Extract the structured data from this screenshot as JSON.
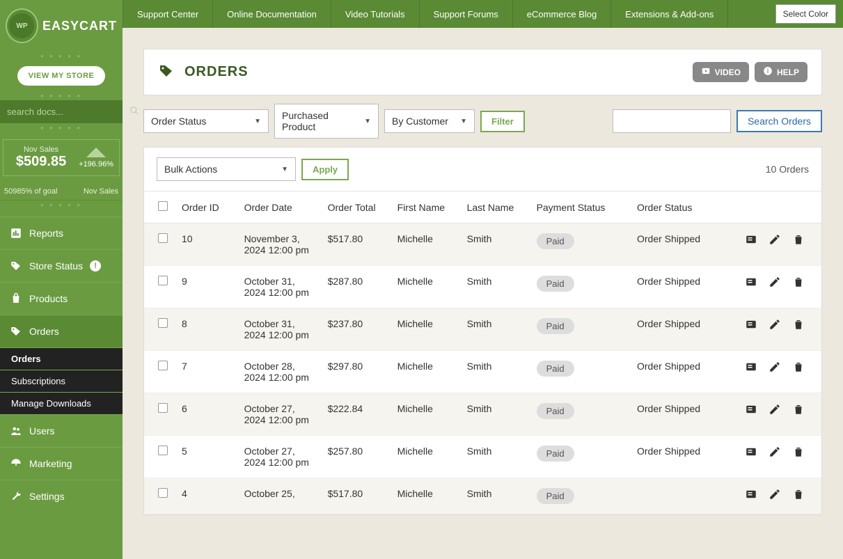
{
  "brand": {
    "name": "EASYCART",
    "logo_text": "WP"
  },
  "view_store": "VIEW MY STORE",
  "search_docs_placeholder": "search docs...",
  "stats": {
    "label": "Nov Sales",
    "amount": "$509.85",
    "pct": "+196.96%"
  },
  "goal": {
    "left": "50985% of goal",
    "right": "Nov Sales"
  },
  "nav": {
    "reports": "Reports",
    "store_status": "Store Status",
    "products": "Products",
    "orders": "Orders",
    "users": "Users",
    "marketing": "Marketing",
    "settings": "Settings"
  },
  "subnav": {
    "orders": "Orders",
    "subscriptions": "Subscriptions",
    "manage_downloads": "Manage Downloads"
  },
  "topbar": {
    "support_center": "Support Center",
    "online_docs": "Online Documentation",
    "video_tutorials": "Video Tutorials",
    "support_forums": "Support Forums",
    "blog": "eCommerce Blog",
    "extensions": "Extensions & Add-ons",
    "select_color": "Select Color"
  },
  "page": {
    "title": "ORDERS",
    "video": "VIDEO",
    "help": "HELP"
  },
  "filters": {
    "order_status": "Order Status",
    "purchased_product": "Purchased Product",
    "by_customer": "By Customer",
    "filter": "Filter",
    "search_orders": "Search Orders"
  },
  "bulk": {
    "label": "Bulk Actions",
    "apply": "Apply"
  },
  "count_text": "10 Orders",
  "columns": {
    "order_id": "Order ID",
    "order_date": "Order Date",
    "order_total": "Order Total",
    "first_name": "First Name",
    "last_name": "Last Name",
    "payment_status": "Payment Status",
    "order_status": "Order Status"
  },
  "rows": [
    {
      "id": "10",
      "date": "November 3, 2024 12:00 pm",
      "total": "$517.80",
      "first": "Michelle",
      "last": "Smith",
      "pay": "Paid",
      "status": "Order Shipped"
    },
    {
      "id": "9",
      "date": "October 31, 2024 12:00 pm",
      "total": "$287.80",
      "first": "Michelle",
      "last": "Smith",
      "pay": "Paid",
      "status": "Order Shipped"
    },
    {
      "id": "8",
      "date": "October 31, 2024 12:00 pm",
      "total": "$237.80",
      "first": "Michelle",
      "last": "Smith",
      "pay": "Paid",
      "status": "Order Shipped"
    },
    {
      "id": "7",
      "date": "October 28, 2024 12:00 pm",
      "total": "$297.80",
      "first": "Michelle",
      "last": "Smith",
      "pay": "Paid",
      "status": "Order Shipped"
    },
    {
      "id": "6",
      "date": "October 27, 2024 12:00 pm",
      "total": "$222.84",
      "first": "Michelle",
      "last": "Smith",
      "pay": "Paid",
      "status": "Order Shipped"
    },
    {
      "id": "5",
      "date": "October 27, 2024 12:00 pm",
      "total": "$257.80",
      "first": "Michelle",
      "last": "Smith",
      "pay": "Paid",
      "status": "Order Shipped"
    },
    {
      "id": "4",
      "date": "October 25,",
      "total": "$517.80",
      "first": "Michelle",
      "last": "Smith",
      "pay": "Paid",
      "status": ""
    }
  ]
}
